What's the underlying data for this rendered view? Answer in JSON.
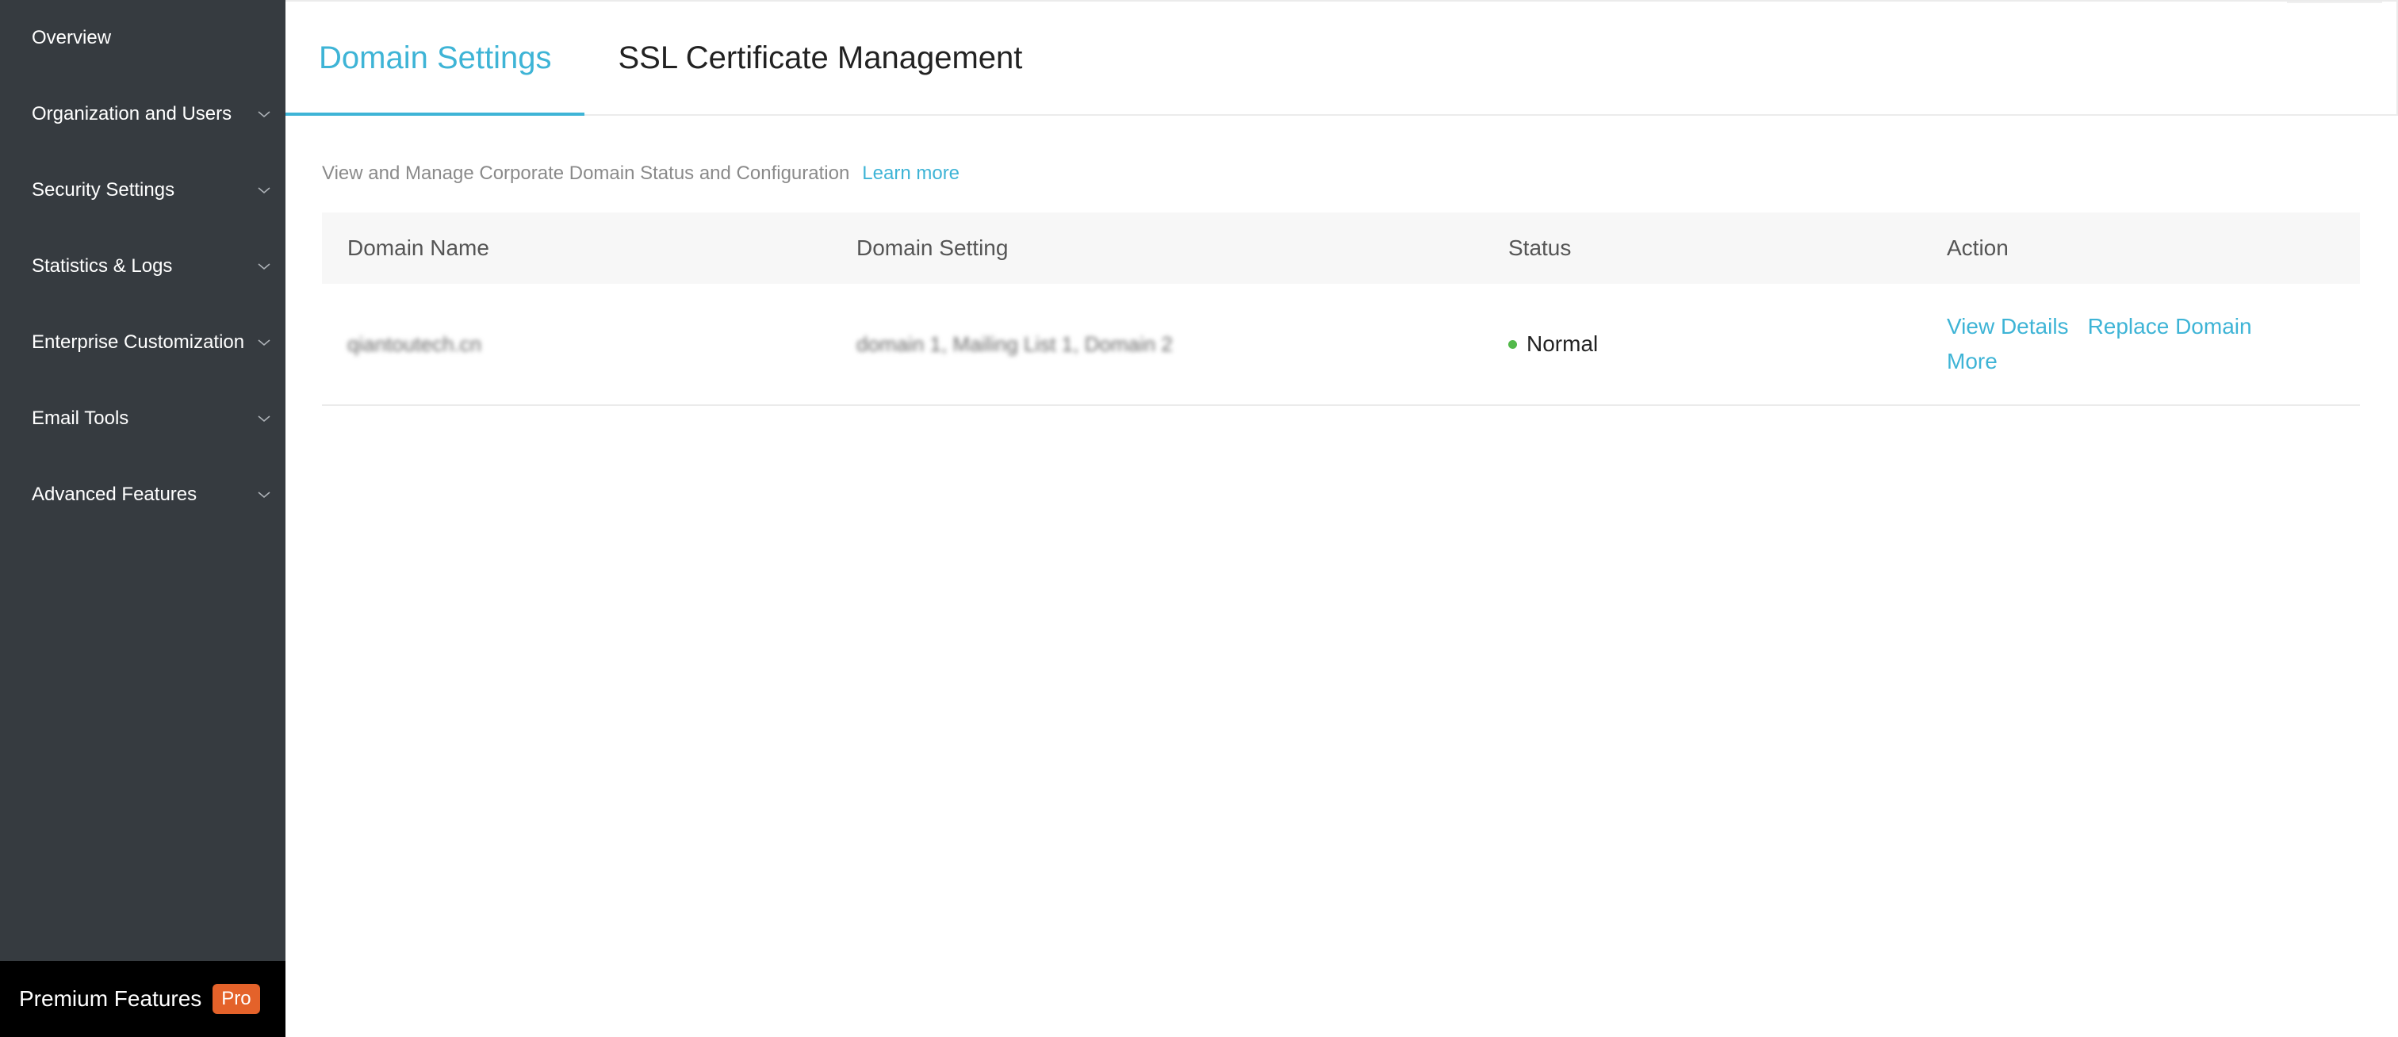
{
  "sidebar": {
    "items": [
      {
        "label": "Overview",
        "has_chevron": false
      },
      {
        "label": "Organization and Users",
        "has_chevron": true
      },
      {
        "label": "Security Settings",
        "has_chevron": true
      },
      {
        "label": "Statistics & Logs",
        "has_chevron": true
      },
      {
        "label": "Enterprise Customization",
        "has_chevron": true
      },
      {
        "label": "Email Tools",
        "has_chevron": true
      },
      {
        "label": "Advanced Features",
        "has_chevron": true
      }
    ],
    "premium": {
      "label": "Premium Features",
      "badge": "Pro"
    },
    "chevron_icon": "chevron-down-icon"
  },
  "tabs": [
    {
      "label": "Domain Settings",
      "active": true
    },
    {
      "label": "SSL Certificate Management",
      "active": false
    }
  ],
  "description": {
    "text": "View and Manage Corporate Domain Status and Configuration",
    "link": "Learn more"
  },
  "table": {
    "headers": {
      "name": "Domain Name",
      "setting": "Domain Setting",
      "status": "Status",
      "action": "Action"
    },
    "rows": [
      {
        "name": "qiantoutech.cn",
        "setting": "domain 1, Mailing List 1, Domain 2",
        "status": "Normal",
        "actions": {
          "view": "View Details",
          "replace": "Replace Domain",
          "more": "More"
        }
      }
    ]
  },
  "colors": {
    "accent": "#3eb4d6",
    "sidebar_bg": "#363b40",
    "status_normal": "#52b94a",
    "pro_badge": "#e4622a"
  }
}
